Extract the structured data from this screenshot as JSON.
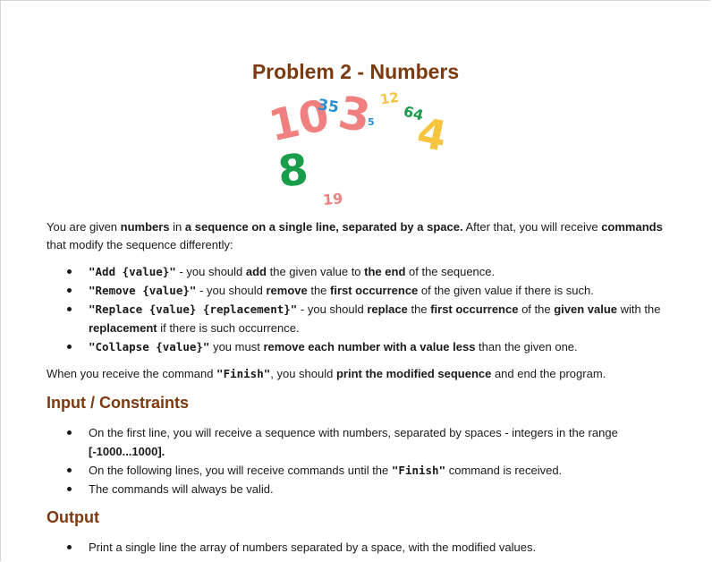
{
  "title": "Problem 2 - Numbers",
  "art_numbers": [
    {
      "text": "10",
      "color": "#f08080"
    },
    {
      "text": "35",
      "color": "#2a8fd0"
    },
    {
      "text": "3",
      "color": "#f08080"
    },
    {
      "text": "5",
      "color": "#2a8fd0"
    },
    {
      "text": "12",
      "color": "#f5c542"
    },
    {
      "text": "64",
      "color": "#1a9d4a"
    },
    {
      "text": "4",
      "color": "#f5c542"
    },
    {
      "text": "8",
      "color": "#1a9d4a"
    },
    {
      "text": "19",
      "color": "#f08080"
    }
  ],
  "intro": {
    "t1": "You are given ",
    "b1": "numbers",
    "t2": " in ",
    "b2": "a sequence on a single line, separated by a space.",
    "t3": " After that, you will receive ",
    "b3": "commands",
    "t4": " that modify the sequence differently:"
  },
  "commands": [
    {
      "code": "\"Add {value}\"",
      "t1": " - you should ",
      "b1": "add",
      "t2": " the given value to ",
      "b2": "the end",
      "t3": " of the sequence.",
      "b3": "",
      "t4": ""
    },
    {
      "code": "\"Remove {value}\"",
      "t1": " - you should ",
      "b1": "remove",
      "t2": " the ",
      "b2": "first occurrence",
      "t3": " of the given value if there is such.",
      "b3": "",
      "t4": ""
    },
    {
      "code": "\"Replace {value} {replacement}\"",
      "t1": " - you should ",
      "b1": "replace",
      "t2": " the ",
      "b2": "first occurrence",
      "t3": " of the ",
      "b3": "given value",
      "t4": " with the "
    },
    {
      "code": "\"Collapse {value}\"",
      "t1": " you must ",
      "b1": "remove each number with a value less",
      "t2": " than the given one.",
      "b2": "",
      "t3": "",
      "b3": "",
      "t4": ""
    }
  ],
  "replace_tail": {
    "b": "replacement",
    "t": " if there is such occurrence."
  },
  "finish_line": {
    "t1": "When you receive the command ",
    "code": "\"Finish\"",
    "t2": ", you should ",
    "b1": "print the modified sequence",
    "t3": " and end the program."
  },
  "input_heading": "Input / Constraints",
  "input_items": {
    "i1_t": "On the first line, you will receive a sequence with numbers, separated by spaces - integers in the range ",
    "i1_b": "[-1000...1000].",
    "i2_t1": "On the following lines, you will receive commands until the ",
    "i2_code": "\"Finish\"",
    "i2_t2": " command is received.",
    "i3": "The commands will always be valid."
  },
  "output_heading": "Output",
  "output_items": [
    "Print a single line the array of numbers separated by a space, with the modified values."
  ]
}
